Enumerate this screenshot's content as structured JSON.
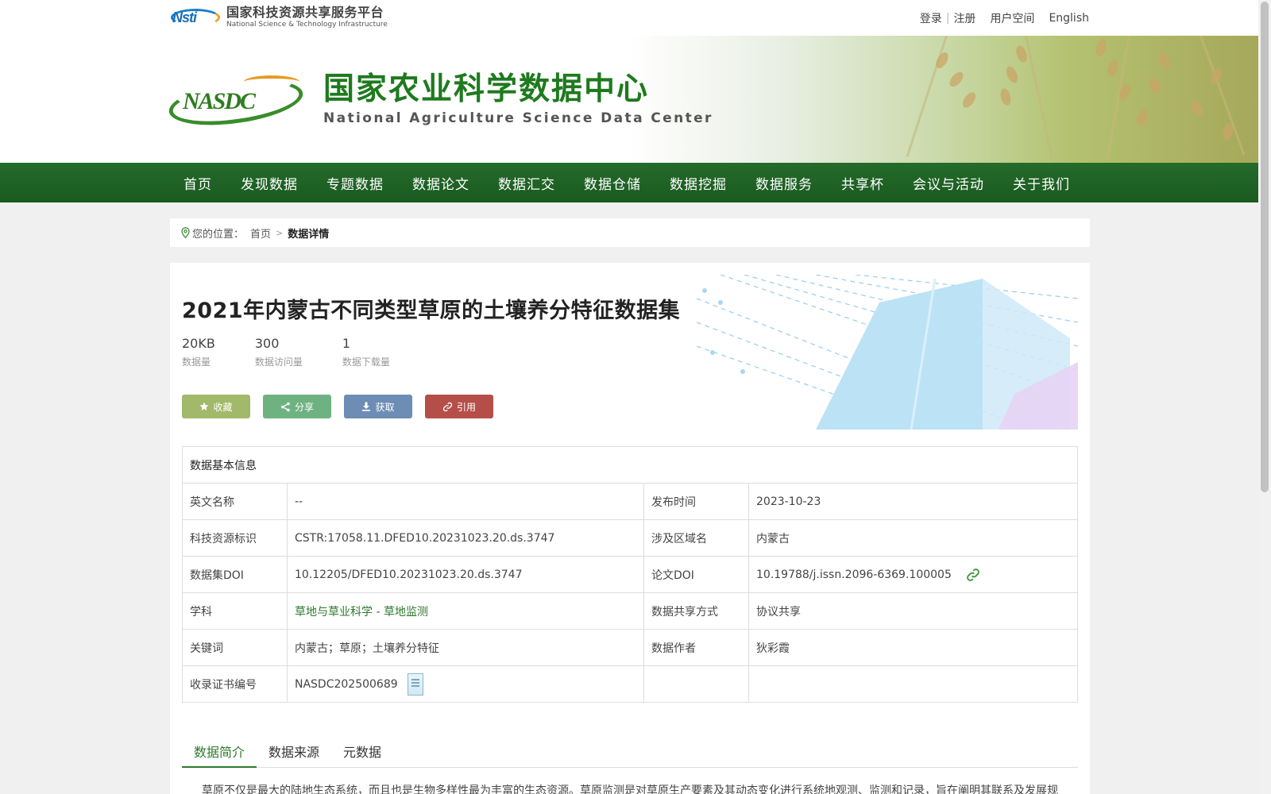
{
  "top": {
    "platform_cn": "国家科技资源共享服务平台",
    "platform_en": "National Science & Technology Infrastructure",
    "logo_text": "Nsti",
    "links": {
      "login": "登录",
      "register": "注册",
      "user_space": "用户空间",
      "english": "English"
    }
  },
  "banner": {
    "logo_text": "NASDC",
    "title_cn": "国家农业科学数据中心",
    "title_en": "National Agriculture Science Data Center"
  },
  "nav": [
    "首页",
    "发现数据",
    "专题数据",
    "数据论文",
    "数据汇交",
    "数据仓储",
    "数据挖掘",
    "数据服务",
    "共享杯",
    "会议与活动",
    "关于我们"
  ],
  "breadcrumb": {
    "prefix": "您的位置：",
    "home": "首页",
    "current": "数据详情"
  },
  "dataset": {
    "title": "2021年内蒙古不同类型草原的土壤养分特征数据集",
    "stats": [
      {
        "value": "20KB",
        "label": "数据量"
      },
      {
        "value": "300",
        "label": "数据访问量"
      },
      {
        "value": "1",
        "label": "数据下载量"
      }
    ],
    "actions": {
      "favorite": "收藏",
      "share": "分享",
      "get": "获取",
      "cite": "引用"
    }
  },
  "info": {
    "heading": "数据基本信息",
    "rows": [
      {
        "k1": "英文名称",
        "v1": "--",
        "k2": "发布时间",
        "v2": "2023-10-23"
      },
      {
        "k1": "科技资源标识",
        "v1": "CSTR:17058.11.DFED10.20231023.20.ds.3747",
        "k2": "涉及区域名",
        "v2": "内蒙古"
      },
      {
        "k1": "数据集DOI",
        "v1": "10.12205/DFED10.20231023.20.ds.3747",
        "k2": "论文DOI",
        "v2": "10.19788/j.issn.2096-6369.100005"
      },
      {
        "k1": "学科",
        "v1": "草地与草业科学 - 草地监测",
        "k2": "数据共享方式",
        "v2": "协议共享"
      },
      {
        "k1": "关键词",
        "v1": "内蒙古；草原；土壤养分特征",
        "k2": "数据作者",
        "v2": "狄彩霞"
      },
      {
        "k1": "收录证书编号",
        "v1": "NASDC202500689",
        "k2": "",
        "v2": ""
      }
    ]
  },
  "tabs": [
    "数据简介",
    "数据来源",
    "元数据"
  ],
  "description": "草原不仅是最大的陆地生态系统，而且也是生物多样性最为丰富的生态资源。草原监测是对草原生产要素及其动态变化进行系统地观测、监测和记录，旨在阐明其联系及发展规",
  "colors": {
    "nav": "#1e6325",
    "accent": "#2d7a2d",
    "fav": "#a2b86a",
    "share": "#6fb281",
    "get": "#6d8db5",
    "cite": "#b54e49"
  }
}
